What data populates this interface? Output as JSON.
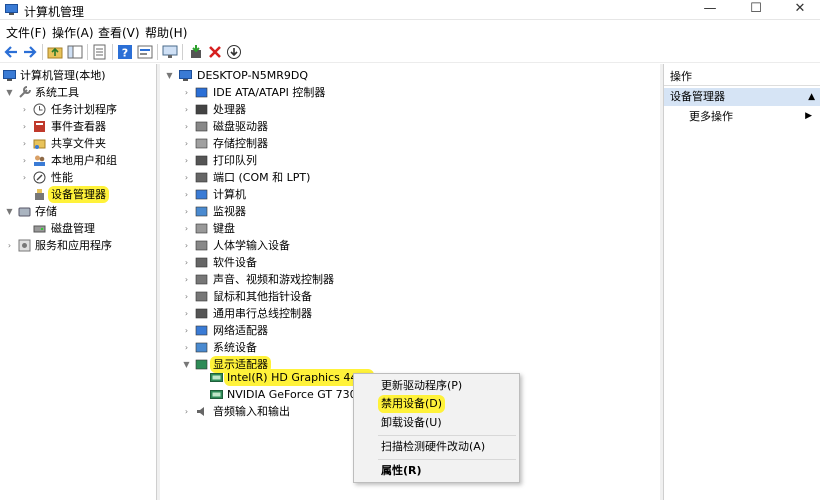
{
  "window": {
    "title": "计算机管理",
    "controls": {
      "minimize": "—",
      "maximize": "☐",
      "close": "✕"
    }
  },
  "menu": [
    "文件(F)",
    "操作(A)",
    "查看(V)",
    "帮助(H)"
  ],
  "left_tree": [
    {
      "label": "计算机管理(本地)",
      "expander": "",
      "icon": "computer-management-icon"
    },
    {
      "label": "系统工具",
      "expander": "▼",
      "icon": "system-tools-icon"
    },
    {
      "label": "任务计划程序",
      "expander": "›",
      "icon": "task-scheduler-icon"
    },
    {
      "label": "事件查看器",
      "expander": "›",
      "icon": "event-viewer-icon"
    },
    {
      "label": "共享文件夹",
      "expander": "›",
      "icon": "shared-folder-icon"
    },
    {
      "label": "本地用户和组",
      "expander": "›",
      "icon": "users-icon"
    },
    {
      "label": "性能",
      "expander": "›",
      "icon": "performance-icon"
    },
    {
      "label": "设备管理器",
      "expander": "",
      "icon": "device-manager-icon",
      "highlight": true
    },
    {
      "label": "存储",
      "expander": "▼",
      "icon": "storage-icon"
    },
    {
      "label": "磁盘管理",
      "expander": "",
      "icon": "disk-icon"
    },
    {
      "label": "服务和应用程序",
      "expander": "›",
      "icon": "services-icon"
    }
  ],
  "device_tree": {
    "root": "DESKTOP-N5MR9DQ",
    "categories": [
      {
        "label": "IDE ATA/ATAPI 控制器",
        "icon": "ide-controller-icon"
      },
      {
        "label": "处理器",
        "icon": "processor-icon"
      },
      {
        "label": "磁盘驱动器",
        "icon": "disk-drive-icon"
      },
      {
        "label": "存储控制器",
        "icon": "storage-controller-icon"
      },
      {
        "label": "打印队列",
        "icon": "printer-icon"
      },
      {
        "label": "端口 (COM 和 LPT)",
        "icon": "port-icon"
      },
      {
        "label": "计算机",
        "icon": "computer-icon"
      },
      {
        "label": "监视器",
        "icon": "monitor-icon"
      },
      {
        "label": "键盘",
        "icon": "keyboard-icon"
      },
      {
        "label": "人体学输入设备",
        "icon": "hid-icon"
      },
      {
        "label": "软件设备",
        "icon": "software-device-icon"
      },
      {
        "label": "声音、视频和游戏控制器",
        "icon": "sound-icon"
      },
      {
        "label": "鼠标和其他指针设备",
        "icon": "mouse-icon"
      },
      {
        "label": "通用串行总线控制器",
        "icon": "usb-icon"
      },
      {
        "label": "网络适配器",
        "icon": "network-adapter-icon"
      },
      {
        "label": "系统设备",
        "icon": "system-device-icon"
      },
      {
        "label": "显示适配器",
        "icon": "display-adapter-icon",
        "expanded": true,
        "highlight": true
      }
    ],
    "display_adapters": [
      {
        "label": "Intel(R) HD Graphics 4400",
        "highlight": true
      },
      {
        "label": "NVIDIA GeForce GT 730"
      }
    ],
    "after": [
      {
        "label": "音频输入和输出",
        "icon": "audio-icon"
      }
    ]
  },
  "actions_pane": {
    "header": "操作",
    "section": "设备管理器",
    "more_actions": "更多操作"
  },
  "context_menu": {
    "items": [
      "更新驱动程序(P)",
      "禁用设备(D)",
      "卸载设备(U)",
      "扫描检测硬件改动(A)",
      "属性(R)"
    ]
  },
  "colors": {
    "highlight": "#fff23a",
    "section_bg": "#d6e4f5",
    "menu_bg": "#f2f2f2"
  }
}
